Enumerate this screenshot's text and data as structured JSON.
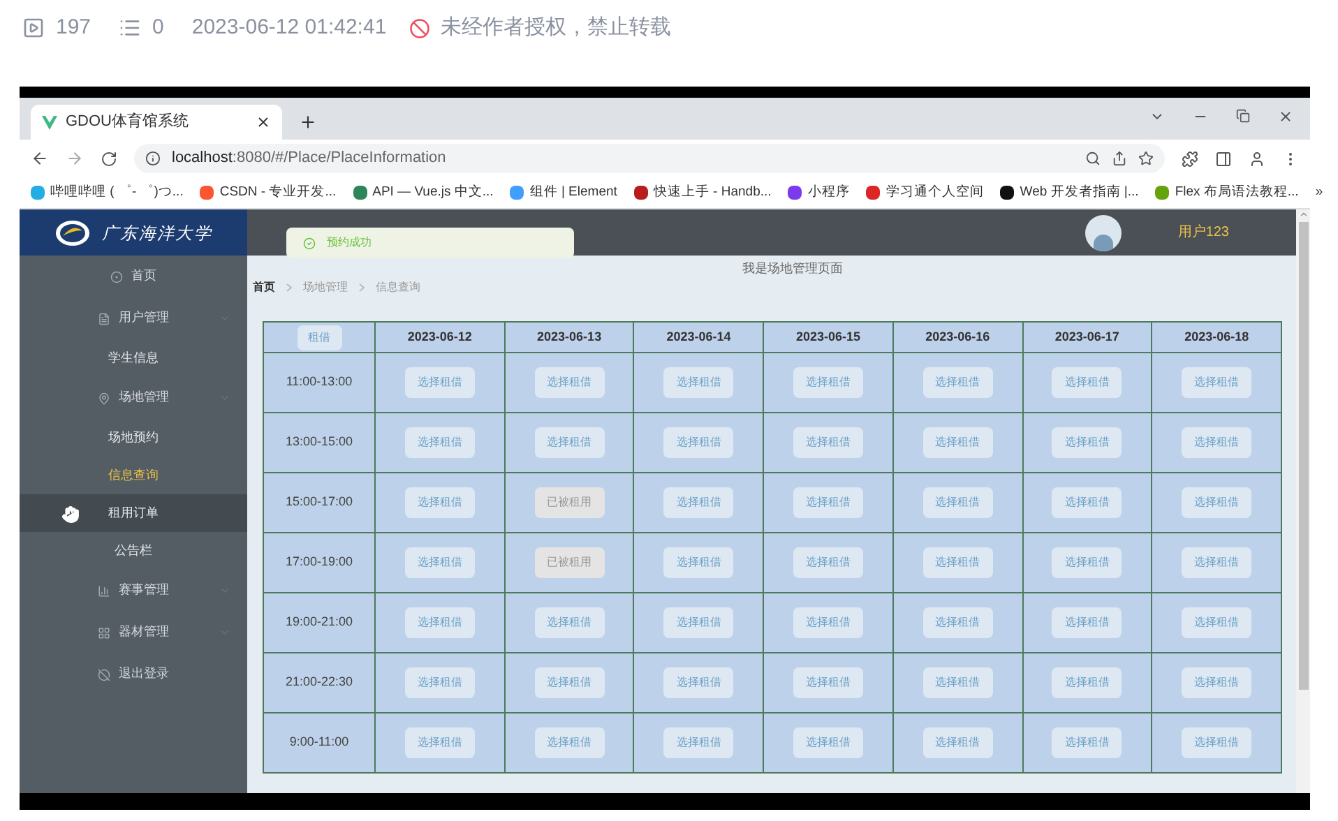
{
  "meta": {
    "views": "197",
    "comments": "0",
    "datetime": "2023-06-12 01:42:41",
    "notice": "未经作者授权，禁止转载"
  },
  "browser": {
    "tab_title": "GDOU体育馆系统",
    "url_host": "localhost",
    "url_rest": ":8080/#/Place/PlaceInformation",
    "bookmarks": [
      {
        "label": "哔哩哔哩 ( ゜- ゜)つ...",
        "color": "#23ade5"
      },
      {
        "label": "CSDN - 专业开发...",
        "color": "#fc5531"
      },
      {
        "label": "API — Vue.js 中文...",
        "color": "#2f855a"
      },
      {
        "label": "组件 | Element",
        "color": "#409eff"
      },
      {
        "label": "快速上手 - Handb...",
        "color": "#b91c1c"
      },
      {
        "label": "小程序",
        "color": "#7c3aed"
      },
      {
        "label": "学习通个人空间",
        "color": "#dc2626"
      },
      {
        "label": "Web 开发者指南 |...",
        "color": "#111111"
      },
      {
        "label": "Flex 布局语法教程...",
        "color": "#65a30d"
      }
    ],
    "more": "»"
  },
  "app": {
    "logo_text": "广东海洋大学",
    "user": "用户123",
    "toast": "预约成功",
    "page_title": "我是场地管理页面",
    "breadcrumb": [
      {
        "label": "首页",
        "selected": true
      },
      {
        "label": "场地管理",
        "selected": false
      },
      {
        "label": "信息查询",
        "selected": false
      }
    ],
    "sidebar": [
      {
        "kind": "item",
        "label": "首页"
      },
      {
        "kind": "group",
        "label": "用户管理",
        "children": [
          {
            "label": "学生信息",
            "selected": false,
            "hovered": false
          }
        ]
      },
      {
        "kind": "group",
        "label": "场地管理",
        "children": [
          {
            "label": "场地预约",
            "selected": false,
            "hovered": false
          },
          {
            "label": "信息查询",
            "selected": true,
            "hovered": false
          },
          {
            "label": "租用订单",
            "selected": false,
            "hovered": true
          },
          {
            "label": "公告栏",
            "selected": false,
            "hovered": false
          }
        ]
      },
      {
        "kind": "group",
        "label": "赛事管理"
      },
      {
        "kind": "group",
        "label": "器材管理"
      },
      {
        "kind": "item",
        "label": "退出登录"
      }
    ],
    "table": {
      "corner_button": "租借",
      "columns": [
        "2023-06-12",
        "2023-06-13",
        "2023-06-14",
        "2023-06-15",
        "2023-06-16",
        "2023-06-17",
        "2023-06-18"
      ],
      "rows": [
        {
          "time": "11:00-13:00",
          "cells": [
            {
              "text": "选择租借",
              "booked": false
            },
            {
              "text": "选择租借",
              "booked": false
            },
            {
              "text": "选择租借",
              "booked": false
            },
            {
              "text": "选择租借",
              "booked": false
            },
            {
              "text": "选择租借",
              "booked": false
            },
            {
              "text": "选择租借",
              "booked": false
            },
            {
              "text": "选择租借",
              "booked": false
            }
          ]
        },
        {
          "time": "13:00-15:00",
          "cells": [
            {
              "text": "选择租借",
              "booked": false
            },
            {
              "text": "选择租借",
              "booked": false
            },
            {
              "text": "选择租借",
              "booked": false
            },
            {
              "text": "选择租借",
              "booked": false
            },
            {
              "text": "选择租借",
              "booked": false
            },
            {
              "text": "选择租借",
              "booked": false
            },
            {
              "text": "选择租借",
              "booked": false
            }
          ]
        },
        {
          "time": "15:00-17:00",
          "cells": [
            {
              "text": "选择租借",
              "booked": false
            },
            {
              "text": "已被租用",
              "booked": true
            },
            {
              "text": "选择租借",
              "booked": false
            },
            {
              "text": "选择租借",
              "booked": false
            },
            {
              "text": "选择租借",
              "booked": false
            },
            {
              "text": "选择租借",
              "booked": false
            },
            {
              "text": "选择租借",
              "booked": false
            }
          ]
        },
        {
          "time": "17:00-19:00",
          "cells": [
            {
              "text": "选择租借",
              "booked": false
            },
            {
              "text": "已被租用",
              "booked": true
            },
            {
              "text": "选择租借",
              "booked": false
            },
            {
              "text": "选择租借",
              "booked": false
            },
            {
              "text": "选择租借",
              "booked": false
            },
            {
              "text": "选择租借",
              "booked": false
            },
            {
              "text": "选择租借",
              "booked": false
            }
          ]
        },
        {
          "time": "19:00-21:00",
          "cells": [
            {
              "text": "选择租借",
              "booked": false
            },
            {
              "text": "选择租借",
              "booked": false
            },
            {
              "text": "选择租借",
              "booked": false
            },
            {
              "text": "选择租借",
              "booked": false
            },
            {
              "text": "选择租借",
              "booked": false
            },
            {
              "text": "选择租借",
              "booked": false
            },
            {
              "text": "选择租借",
              "booked": false
            }
          ]
        },
        {
          "time": "21:00-22:30",
          "cells": [
            {
              "text": "选择租借",
              "booked": false
            },
            {
              "text": "选择租借",
              "booked": false
            },
            {
              "text": "选择租借",
              "booked": false
            },
            {
              "text": "选择租借",
              "booked": false
            },
            {
              "text": "选择租借",
              "booked": false
            },
            {
              "text": "选择租借",
              "booked": false
            },
            {
              "text": "选择租借",
              "booked": false
            }
          ]
        },
        {
          "time": "9:00-11:00",
          "cells": [
            {
              "text": "选择租借",
              "booked": false
            },
            {
              "text": "选择租借",
              "booked": false
            },
            {
              "text": "选择租借",
              "booked": false
            },
            {
              "text": "选择租借",
              "booked": false
            },
            {
              "text": "选择租借",
              "booked": false
            },
            {
              "text": "选择租借",
              "booked": false
            },
            {
              "text": "选择租借",
              "booked": false
            }
          ]
        }
      ]
    }
  }
}
